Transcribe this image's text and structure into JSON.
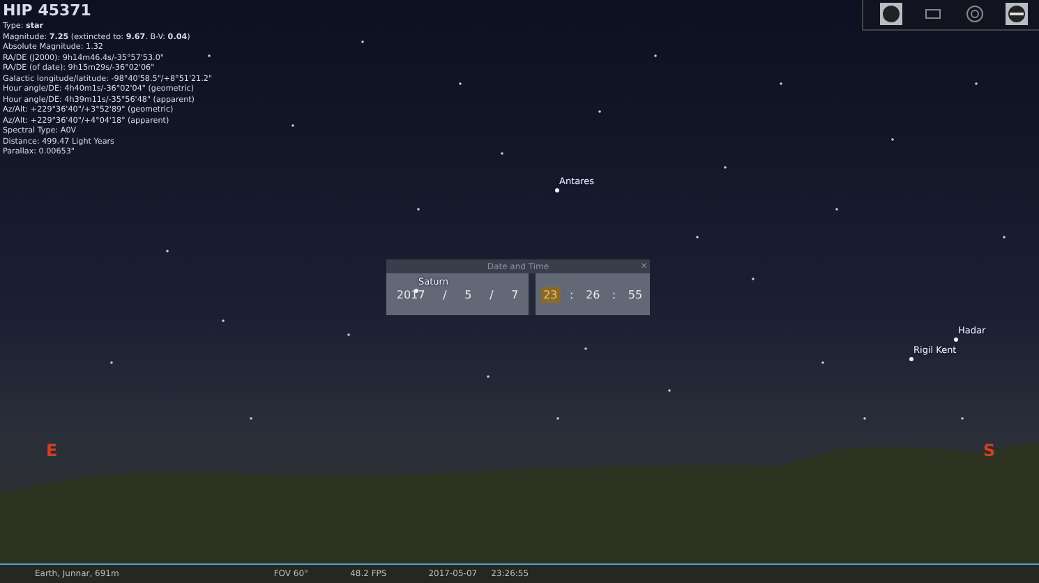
{
  "object_info": {
    "title": "HIP 45371",
    "lines": [
      "Type: **star**",
      "Magnitude: **7.25** (extincted to: **9.67**. B-V: **0.04**)",
      "Absolute Magnitude: 1.32",
      "RA/DE (J2000): 9h14m46.4s/-35°57'53.0\"",
      "RA/DE (of date): 9h15m29s/-36°02'06\"",
      "Galactic longitude/latitude: -98°40'58.5\"/+8°51'21.2\"",
      "Hour angle/DE: 4h40m1s/-36°02'04\" (geometric)",
      "Hour angle/DE: 4h39m11s/-35°56'48\" (apparent)",
      "Az/Alt: +229°36'40\"/+3°52'89\" (geometric)",
      "Az/Alt: +229°36'40\"/+4°04'18\" (apparent)",
      "Spectral Type: A0V",
      "Distance: 499.47 Light Years",
      "Parallax: 0.00653\""
    ]
  },
  "toolbar": [
    {
      "kind": "disc",
      "selected": true
    },
    {
      "kind": "frame",
      "selected": false
    },
    {
      "kind": "target",
      "selected": false
    },
    {
      "kind": "band",
      "selected": true
    }
  ],
  "sky_labels": [
    {
      "text": "Antares"
    },
    {
      "text": "Saturn"
    },
    {
      "text": "Rigil Kent"
    },
    {
      "text": "Hadar"
    }
  ],
  "cardinals": [
    {
      "text": "E"
    },
    {
      "text": "S"
    }
  ],
  "date_time_dialog": {
    "title": "Date and Time",
    "close": "×",
    "date_fields": [
      {
        "value": "2017",
        "selected": false
      },
      {
        "value": "5",
        "selected": false
      },
      {
        "value": "7",
        "selected": false
      }
    ],
    "date_separator": "/",
    "time_fields": [
      {
        "value": "23",
        "selected": true
      },
      {
        "value": "26",
        "selected": false
      },
      {
        "value": "55",
        "selected": false
      }
    ],
    "time_separator": ":"
  },
  "status_bar": {
    "location": "Earth, Junnar, 691m",
    "fov": "FOV 60°",
    "fps": "48.2 FPS",
    "date": "2017-05-07",
    "time": "23:26:55"
  }
}
